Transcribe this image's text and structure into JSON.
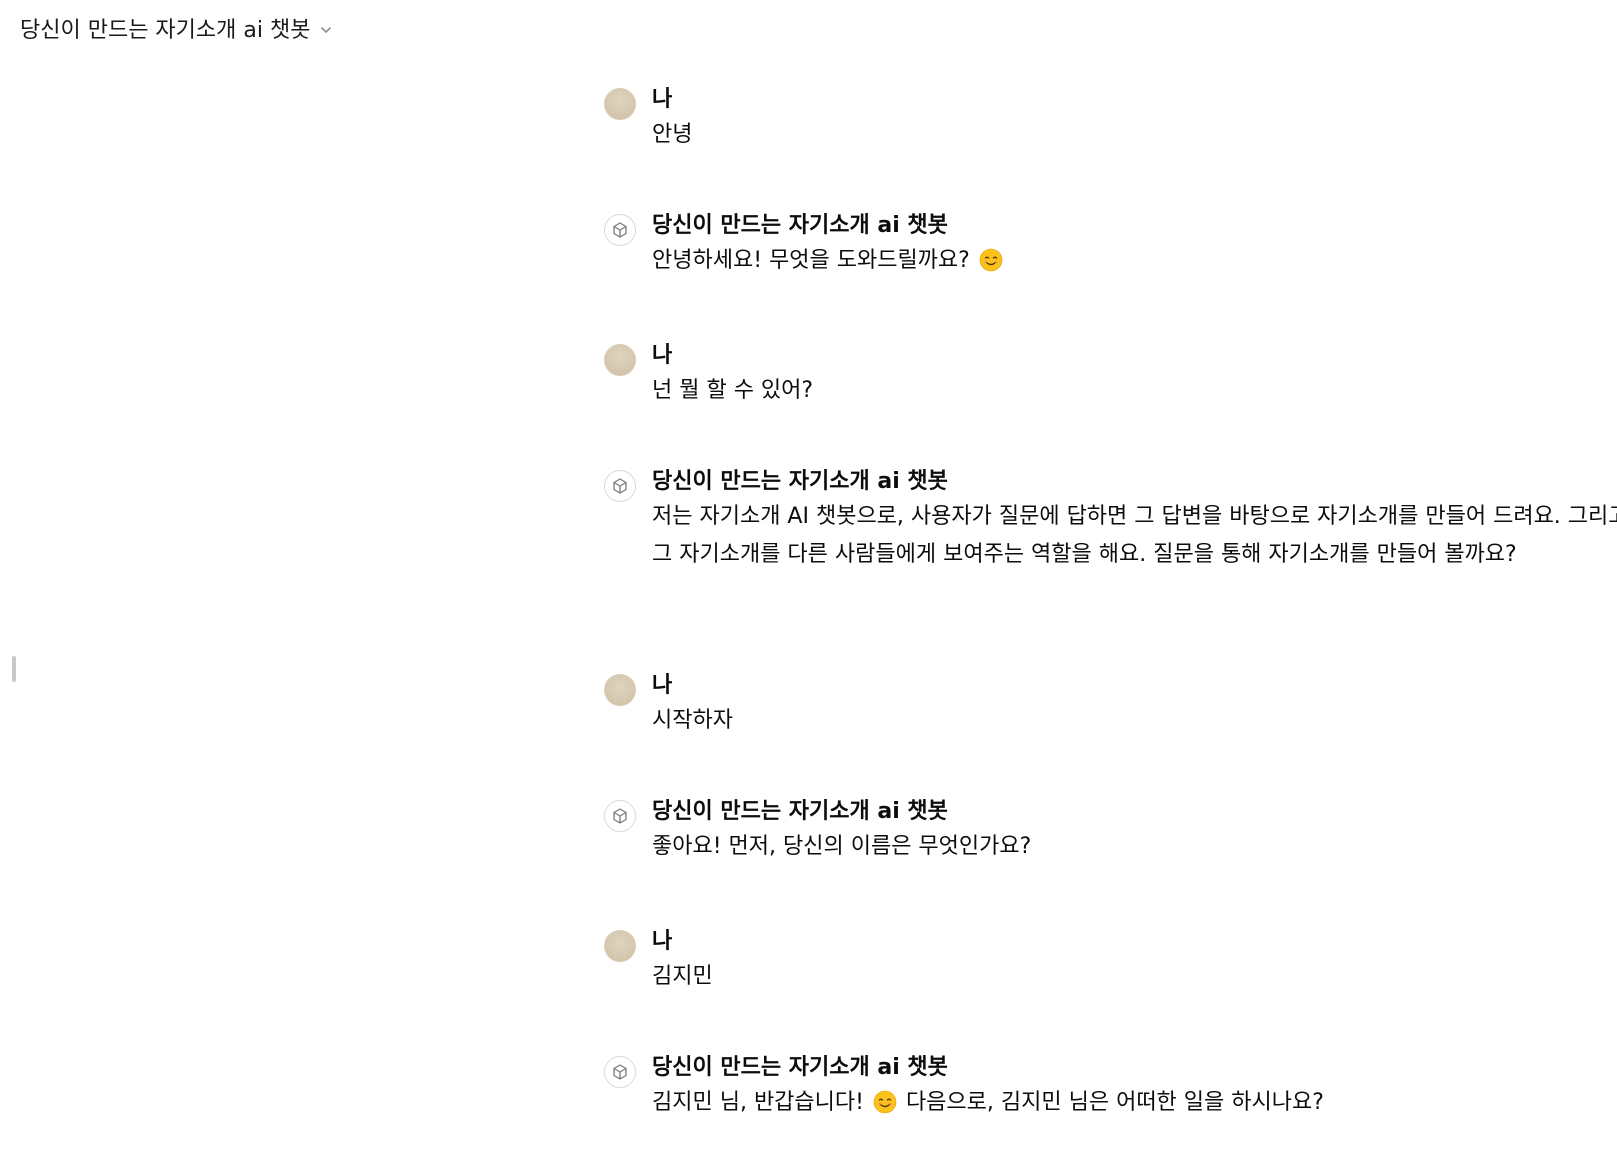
{
  "header": {
    "title": "당신이 만드는 자기소개 ai 챗봇",
    "chevron_icon": "chevron-down-icon"
  },
  "colors": {
    "text": "#0d0d0d",
    "user_avatar": "#d4c6ad",
    "bot_avatar_border": "#d9d9d9"
  },
  "messages": [
    {
      "role": "user",
      "sender": "나",
      "text_before": "안녕",
      "emoji": "",
      "text_after": ""
    },
    {
      "role": "assistant",
      "sender": "당신이 만드는 자기소개 ai 챗봇",
      "text_before": "안녕하세요! 무엇을 도와드릴까요? ",
      "emoji": "smiling-face-emoji",
      "text_after": ""
    },
    {
      "role": "user",
      "sender": "나",
      "text_before": "넌 뭘 할 수 있어?",
      "emoji": "",
      "text_after": ""
    },
    {
      "role": "assistant",
      "sender": "당신이 만드는 자기소개 ai 챗봇",
      "text_before": "저는 자기소개 AI 챗봇으로, 사용자가 질문에 답하면 그 답변을 바탕으로 자기소개를 만들어 드려요. 그리고 그 자기소개를 다른 사람들에게 보여주는 역할을 해요. 질문을 통해 자기소개를 만들어 볼까요?",
      "emoji": "",
      "text_after": ""
    },
    {
      "role": "user",
      "sender": "나",
      "text_before": "시작하자",
      "emoji": "",
      "text_after": ""
    },
    {
      "role": "assistant",
      "sender": "당신이 만드는 자기소개 ai 챗봇",
      "text_before": "좋아요! 먼저, 당신의 이름은 무엇인가요?",
      "emoji": "",
      "text_after": ""
    },
    {
      "role": "user",
      "sender": "나",
      "text_before": "김지민",
      "emoji": "",
      "text_after": ""
    },
    {
      "role": "assistant",
      "sender": "당신이 만드는 자기소개 ai 챗봇",
      "text_before": "김지민 님, 반갑습니다! ",
      "emoji": "smiling-face-emoji",
      "text_after": " 다음으로, 김지민 님은 어떠한 일을 하시나요?"
    }
  ]
}
